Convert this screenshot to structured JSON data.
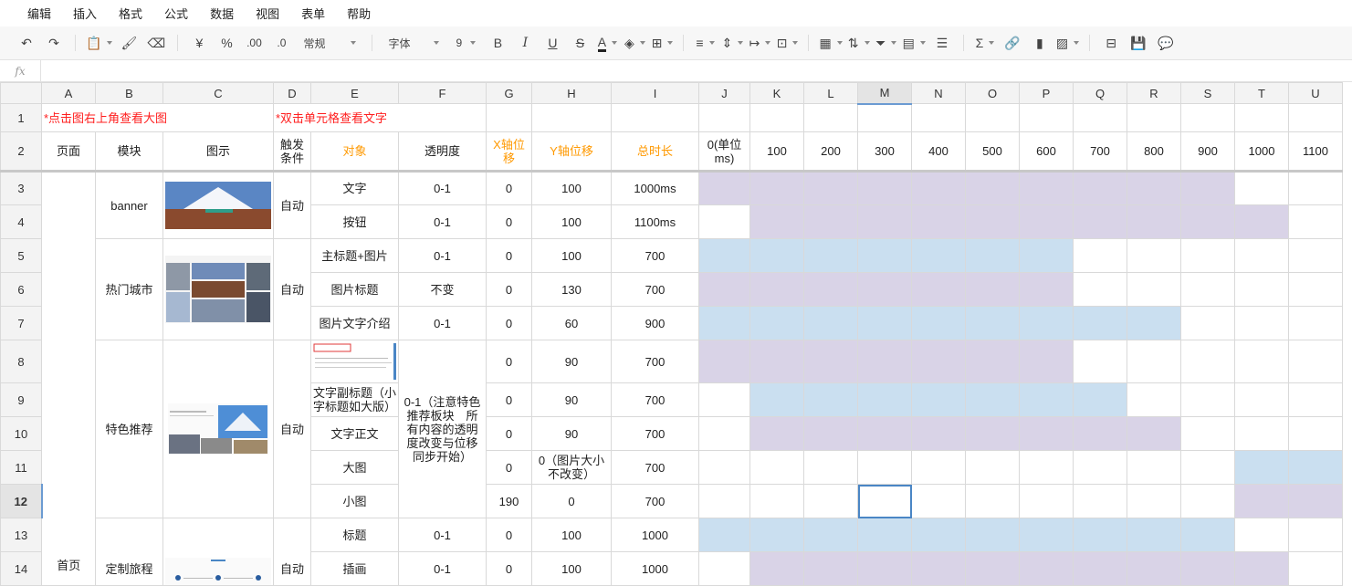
{
  "menu": [
    "编辑",
    "插入",
    "格式",
    "公式",
    "数据",
    "视图",
    "表单",
    "帮助"
  ],
  "toolbar": {
    "format_select": "常规",
    "font_select": "字体",
    "size_select": "9",
    "currency": "¥",
    "percent": "%",
    "dec_inc": ".00",
    "dec_dec": ".0",
    "bold": "B",
    "italic": "I",
    "underline": "U",
    "strike": "S",
    "fontcolor": "A",
    "sum": "Σ"
  },
  "formula": {
    "fx": "fx",
    "value": ""
  },
  "columns": [
    "A",
    "B",
    "C",
    "D",
    "E",
    "F",
    "G",
    "H",
    "I",
    "J",
    "K",
    "L",
    "M",
    "N",
    "O",
    "P",
    "Q",
    "R",
    "S",
    "T",
    "U"
  ],
  "active_column": "M",
  "active_row": "12",
  "row1": {
    "note1": "*点击图右上角查看大图",
    "note2": "*双击单元格查看文字"
  },
  "header": {
    "page": "页面",
    "module": "模块",
    "image": "图示",
    "trigger": "触发条件",
    "target": "对象",
    "opacity": "透明度",
    "x": "X轴位移",
    "y": "Y轴位移",
    "duration": "总时长",
    "timeline": [
      "0(单位ms)",
      "100",
      "200",
      "300",
      "400",
      "500",
      "600",
      "700",
      "800",
      "900",
      "1000",
      "1100"
    ]
  },
  "page_label": "首页",
  "modules": {
    "banner": "banner",
    "hot": "热门城市",
    "feature": "特色推荐",
    "custom": "定制旅程"
  },
  "trigger_auto": "自动",
  "rows": [
    {
      "n": "3",
      "target": "文字",
      "opacity": "0-1",
      "x": "0",
      "y": "100",
      "dur": "1000ms",
      "bar": [
        0,
        10,
        "p"
      ]
    },
    {
      "n": "4",
      "target": "按钮",
      "opacity": "0-1",
      "x": "0",
      "y": "100",
      "dur": "1100ms",
      "bar": [
        1,
        11,
        "p"
      ]
    },
    {
      "n": "5",
      "target": "主标题+图片",
      "opacity": "0-1",
      "x": "0",
      "y": "100",
      "dur": "700",
      "bar": [
        0,
        7,
        "b"
      ]
    },
    {
      "n": "6",
      "target": "图片标题",
      "opacity": "不变",
      "x": "0",
      "y": "130",
      "dur": "700",
      "bar": [
        0,
        7,
        "p"
      ]
    },
    {
      "n": "7",
      "target": "图片文字介绍",
      "opacity": "0-1",
      "x": "0",
      "y": "60",
      "dur": "900",
      "bar": [
        0,
        9,
        "b"
      ]
    },
    {
      "n": "8",
      "target": "",
      "opacity": "",
      "x": "0",
      "y": "90",
      "dur": "700",
      "bar": [
        0,
        7,
        "p"
      ]
    },
    {
      "n": "9",
      "target": "文字副标题（小字标题如大版）",
      "opacity": "",
      "x": "0",
      "y": "90",
      "dur": "700",
      "bar": [
        1,
        8,
        "b"
      ]
    },
    {
      "n": "10",
      "target": "文字正文",
      "opacity": "",
      "x": "0",
      "y": "90",
      "dur": "700",
      "bar": [
        1,
        9,
        "p"
      ]
    },
    {
      "n": "11",
      "target": "大图",
      "opacity": "",
      "x": "0",
      "y": "0（图片大小不改变）",
      "dur": "700",
      "bar": [
        10,
        12,
        "b"
      ]
    },
    {
      "n": "12",
      "target": "小图",
      "opacity": "",
      "x": "190",
      "y": "0",
      "dur": "700",
      "bar": [
        10,
        12,
        "p"
      ]
    },
    {
      "n": "13",
      "target": "标题",
      "opacity": "0-1",
      "x": "0",
      "y": "100",
      "dur": "1000",
      "bar": [
        0,
        10,
        "b"
      ]
    },
    {
      "n": "14",
      "target": "插画",
      "opacity": "0-1",
      "x": "0",
      "y": "100",
      "dur": "1000",
      "bar": [
        1,
        11,
        "p"
      ]
    }
  ],
  "feature_opacity": "0-1（注意特色推荐板块　所有内容的透明度改变与位移同步开始）",
  "colors": {
    "purple": "#d9d3e7",
    "blue": "#cadff0",
    "orange": "#ff9900",
    "red": "#ff1f1f"
  }
}
